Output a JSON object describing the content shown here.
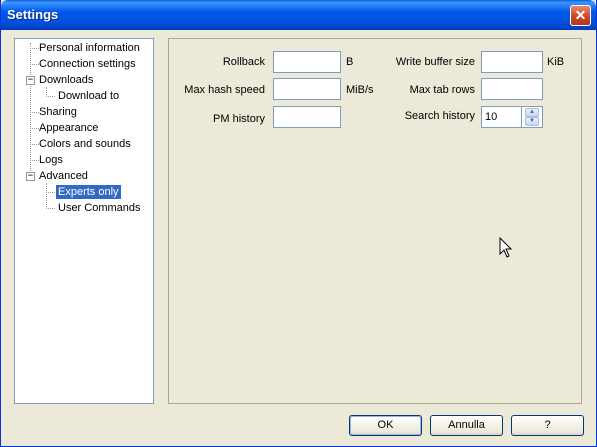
{
  "window": {
    "title": "Settings"
  },
  "tree": {
    "items": [
      {
        "label": "Personal information"
      },
      {
        "label": "Connection settings"
      },
      {
        "label": "Downloads"
      },
      {
        "label": "Download to"
      },
      {
        "label": "Sharing"
      },
      {
        "label": "Appearance"
      },
      {
        "label": "Colors and sounds"
      },
      {
        "label": "Logs"
      },
      {
        "label": "Advanced"
      },
      {
        "label": "Experts only"
      },
      {
        "label": "User Commands"
      }
    ],
    "selected": "Experts only"
  },
  "form": {
    "rollback": {
      "label": "Rollback",
      "value": "",
      "unit": "B"
    },
    "max_hash_speed": {
      "label": "Max hash speed",
      "value": "",
      "unit": "MiB/s"
    },
    "pm_history": {
      "label": "PM history",
      "value": ""
    },
    "write_buffer_size": {
      "label": "Write buffer size",
      "value": "",
      "unit": "KiB"
    },
    "max_tab_rows": {
      "label": "Max tab rows",
      "value": ""
    },
    "search_history": {
      "label": "Search history",
      "value": "10"
    }
  },
  "buttons": {
    "ok": "OK",
    "cancel": "Annulla",
    "help": "?"
  }
}
